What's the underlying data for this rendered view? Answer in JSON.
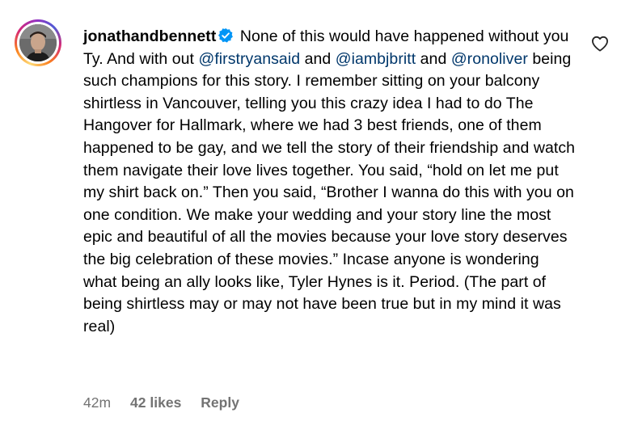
{
  "comment": {
    "username": "jonathandbennett",
    "text_1": " None of this would have happened without you Ty. And with out ",
    "mention_1": "@firstryansaid",
    "text_2": " and ",
    "mention_2": "@iambjbritt",
    "text_3": " and ",
    "mention_3": "@ronoliver",
    "text_4": " being such champions for this story. I remember sitting on your balcony shirtless in Vancouver, telling you this crazy idea I had to do The Hangover for Hallmark, where we had 3 best friends, one of them happened to be gay, and we tell the story of their friendship and watch them navigate their love lives together. You said, “hold on let me put my shirt back on.” Then you said, “Brother I wanna do this with you on one condition. We make your wedding and your story line the most epic and beautiful of all the movies because your love story deserves the big celebration of these movies.” Incase anyone is wondering what being an ally looks like, Tyler Hynes is it. Period. (The part of being shirtless may or may not have been true but in my mind it was real)"
  },
  "meta": {
    "time": "42m",
    "likes": "42 likes",
    "reply": "Reply"
  },
  "icons": {
    "verified": "verified-badge-icon",
    "like": "heart-icon"
  },
  "colors": {
    "mention": "#00376b",
    "verified": "#0095f6",
    "meta": "#737373"
  }
}
